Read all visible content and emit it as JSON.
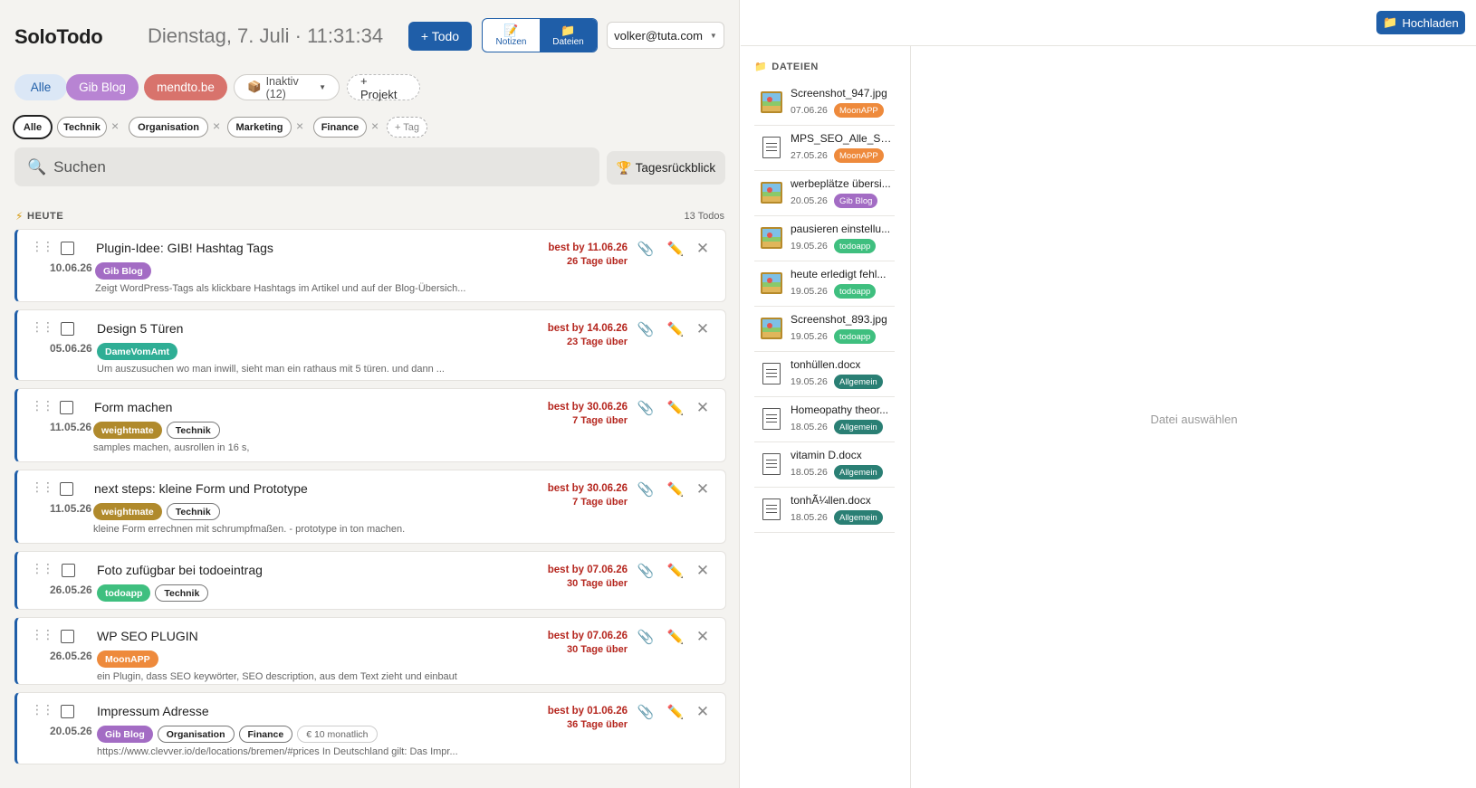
{
  "header": {
    "app_title": "SoloTodo",
    "clock": "Dienstag, 7. Juli · 11:31:34",
    "add_todo_label": "+ Todo",
    "view_toggle": {
      "notes_label": "Notizen",
      "files_label": "Dateien",
      "active": "files"
    },
    "user_email": "volker@tuta.com"
  },
  "projects": {
    "all_label": "Alle",
    "items": [
      {
        "label": "Gib Blog",
        "color": "#b884d3"
      },
      {
        "label": "mendto.be",
        "color": "#d8736c"
      }
    ],
    "inactive_label": "Inaktiv (12)",
    "add_label": "+ Projekt"
  },
  "tag_filter": {
    "all_label": "Alle",
    "tags": [
      "Technik",
      "Organisation",
      "Marketing",
      "Finance"
    ],
    "add_label": "+ Tag",
    "remove_glyph": "×"
  },
  "search": {
    "placeholder": "Suchen",
    "value": ""
  },
  "review_button_label": "Tagesrückblick",
  "section": {
    "title": "HEUTE",
    "count": "13 Todos"
  },
  "todos": [
    {
      "title": "Plugin-Idee: GIB! Hashtag Tags",
      "date": "10.06.26",
      "tags": [
        {
          "label": "Gib Blog",
          "color": "#a36cc4"
        }
      ],
      "description": "Zeigt WordPress-Tags als klickbare Hashtags im Artikel und auf der Blog-Übersich...",
      "due": "best by 11.06.26",
      "overdue": "26 Tage über"
    },
    {
      "title": "Design 5 Türen",
      "date": "05.06.26",
      "tags": [
        {
          "label": "DameVomAmt",
          "color": "#2fae95"
        }
      ],
      "description": "Um auszusuchen wo man inwill, sieht man ein rathaus mit 5 türen.  und dann ...",
      "due": "best by 14.06.26",
      "overdue": "23 Tage über"
    },
    {
      "title": "Form machen",
      "date": "11.05.26",
      "tags": [
        {
          "label": "weightmate",
          "color": "#b08a2c"
        },
        {
          "label": "Technik",
          "outline": true
        }
      ],
      "description": "samples machen, ausrollen in 16 s,",
      "due": "best by 30.06.26",
      "overdue": "7 Tage über"
    },
    {
      "title": "next steps: kleine Form und Prototype",
      "date": "11.05.26",
      "tags": [
        {
          "label": "weightmate",
          "color": "#b08a2c"
        },
        {
          "label": "Technik",
          "outline": true
        }
      ],
      "description": "kleine Form errechnen mit schrumpfmaßen.  - prototype in ton machen.",
      "due": "best by 30.06.26",
      "overdue": "7 Tage über"
    },
    {
      "title": "Foto zufügbar bei todoeintrag",
      "date": "26.05.26",
      "tags": [
        {
          "label": "todoapp",
          "color": "#3fbf7f"
        },
        {
          "label": "Technik",
          "outline": true
        }
      ],
      "description": "",
      "due": "best by 07.06.26",
      "overdue": "30 Tage über"
    },
    {
      "title": "WP SEO PLUGIN",
      "date": "26.05.26",
      "tags": [
        {
          "label": "MoonAPP",
          "color": "#ee8a3c"
        }
      ],
      "description": "ein Plugin, dass SEO keywörter, SEO description, aus dem Text zieht und einbaut",
      "due": "best by 07.06.26",
      "overdue": "30 Tage über"
    },
    {
      "title": "Impressum Adresse",
      "date": "20.05.26",
      "tags": [
        {
          "label": "Gib Blog",
          "color": "#a36cc4"
        },
        {
          "label": "Organisation",
          "outline": true
        },
        {
          "label": "Finance",
          "outline": true
        },
        {
          "label": "€ 10 monatlich",
          "cost": true
        }
      ],
      "description": "https://www.clevver.io/de/locations/bremen/#prices In Deutschland gilt: Das Impr...",
      "due": "best by 01.06.26",
      "overdue": "36 Tage über"
    }
  ],
  "files_panel": {
    "upload_label": "Hochladen",
    "section_title": "DATEIEN",
    "empty_state": "Datei auswählen",
    "files": [
      {
        "name": "Screenshot_947.jpg",
        "date": "07.06.26",
        "tag": "MoonAPP",
        "tag_color": "#ee8a3c",
        "kind": "image"
      },
      {
        "name": "MPS_SEO_Alle_Spra...",
        "date": "27.05.26",
        "tag": "MoonAPP",
        "tag_color": "#ee8a3c",
        "kind": "doc"
      },
      {
        "name": "werbeplätze übersi...",
        "date": "20.05.26",
        "tag": "Gib Blog",
        "tag_color": "#a36cc4",
        "kind": "image"
      },
      {
        "name": "pausieren einstellu...",
        "date": "19.05.26",
        "tag": "todoapp",
        "tag_color": "#3fbf7f",
        "kind": "image"
      },
      {
        "name": "heute erledigt fehl...",
        "date": "19.05.26",
        "tag": "todoapp",
        "tag_color": "#3fbf7f",
        "kind": "image"
      },
      {
        "name": "Screenshot_893.jpg",
        "date": "19.05.26",
        "tag": "todoapp",
        "tag_color": "#3fbf7f",
        "kind": "image"
      },
      {
        "name": "tonhüllen.docx",
        "date": "19.05.26",
        "tag": "Allgemein",
        "tag_color": "#2a7f74",
        "kind": "doc"
      },
      {
        "name": "Homeopathy theor...",
        "date": "18.05.26",
        "tag": "Allgemein",
        "tag_color": "#2a7f74",
        "kind": "doc"
      },
      {
        "name": "vitamin D.docx",
        "date": "18.05.26",
        "tag": "Allgemein",
        "tag_color": "#2a7f74",
        "kind": "doc"
      },
      {
        "name": "tonhÃ¼llen.docx",
        "date": "18.05.26",
        "tag": "Allgemein",
        "tag_color": "#2a7f74",
        "kind": "doc"
      }
    ]
  },
  "colors": {
    "primary": "#1f5ea8",
    "overdue": "#b5261e"
  }
}
